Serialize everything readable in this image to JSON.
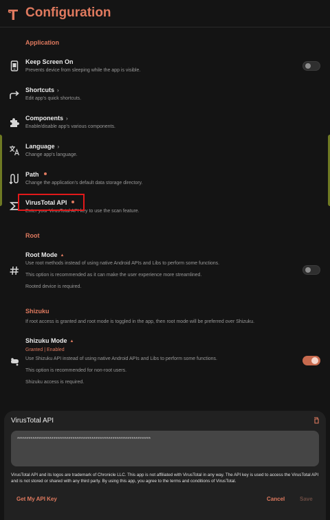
{
  "header": {
    "title": "Configuration",
    "logo_icon": "pick-tool-icon"
  },
  "sections": {
    "application": "Application",
    "root": "Root",
    "shizuku": "Shizuku"
  },
  "settings": {
    "keep_screen_on": {
      "title": "Keep Screen On",
      "subtitle": "Prevents device from sleeping while the app is visible.",
      "icon": "screen-icon",
      "enabled": false
    },
    "shortcuts": {
      "title": "Shortcuts",
      "chevron": "›",
      "subtitle": "Edit app's quick shortcuts.",
      "icon": "shortcut-arrow-icon"
    },
    "components": {
      "title": "Components",
      "chevron": "›",
      "subtitle": "Enable/disable app's various components.",
      "icon": "puzzle-icon"
    },
    "language": {
      "title": "Language",
      "chevron": "›",
      "subtitle": "Change app's language.",
      "icon": "translate-icon"
    },
    "path": {
      "title": "Path",
      "subtitle": "Change the application's default data storage directory.",
      "icon": "path-icon"
    },
    "virustotal": {
      "title": "VirusTotal API",
      "subtitle": "Enter your VirusTotal API key to use the scan feature.",
      "icon": "sigma-icon"
    },
    "root_mode": {
      "title": "Root Mode",
      "line1": "Use root methods instead of using native Android APIs and Libs to perform some functions.",
      "line2": "This option is recommended as it can make the user experience more streamlined.",
      "line3": "Rooted device is required.",
      "icon": "hash-icon",
      "enabled": false
    },
    "shizuku_note": "If root access is granted and root mode is toggled in the app, then root mode will be preferred over Shizuku.",
    "shizuku_mode": {
      "title": "Shizuku Mode",
      "status": "Granted | Enabled",
      "line1": "Use Shizuku API instead of using native Android APIs and Libs to perform some functions.",
      "line2": "This option is recommended for non-root users.",
      "line3": "Shizuku access is required.",
      "icon": "shizuku-icon",
      "enabled": true
    }
  },
  "dialog": {
    "title": "VirusTotal API",
    "corner_icon": "paste-icon",
    "api_key_value": "**********************************************************************",
    "disclaimer": "VirusTotal API and its logos are trademark of Chronicle LLC. This app is not affiliated with VirusTotal in any way. The API key is used to access the VirusTotal API and is not stored or shared with any third party. By using this app, you agree to the terms and conditions of VirusTotal.",
    "get_key_label": "Get My API Key",
    "cancel_label": "Cancel",
    "save_label": "Save"
  },
  "colors": {
    "accent": "#e07a5f",
    "highlight": "#e3191a",
    "background": "#141414",
    "sheet": "#212121",
    "edge": "#6f7a23"
  }
}
